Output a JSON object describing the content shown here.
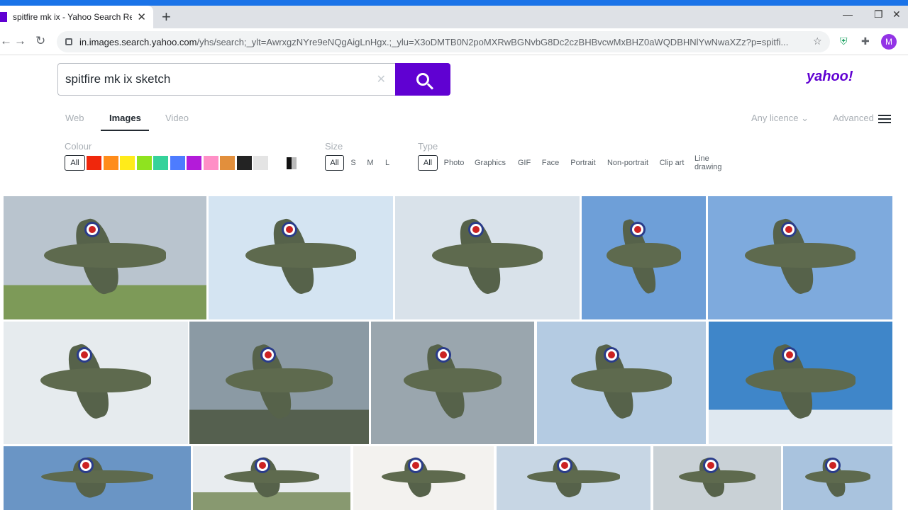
{
  "browser": {
    "tab_title": "spitfire mk ix - Yahoo Search Res",
    "tab_close": "✕",
    "new_tab": "+",
    "url_host": "in.images.search.yahoo.com",
    "url_path": "/yhs/search;_ylt=AwrxgzNYre9eNQgAigLnHgx.;_ylu=X3oDMTB0N2poMXRwBGNvbG8Dc2czBHBvcwMxBHZ0aWQDBHNlYwNwaXZz?p=spitfi...",
    "avatar_letter": "M",
    "minimize": "—",
    "restore": "❐",
    "close": "✕"
  },
  "search": {
    "query": "spitfire mk ix sketch",
    "clear": "✕"
  },
  "brand": "yahoo!",
  "vertical_tabs": [
    "Web",
    "Images",
    "Video"
  ],
  "right_options": {
    "licence": "Any licence",
    "advanced": "Advanced"
  },
  "filters": {
    "colour_label": "Colour",
    "colour_all": "All",
    "colours": [
      "#f0270c",
      "#ff8c1a",
      "#ffeb1a",
      "#8fe31f",
      "#35d29a",
      "#4d7cff",
      "#b31bd9",
      "#ff8fc6",
      "#e28f3c",
      "#232323",
      "#e4e4e4"
    ],
    "size_label": "Size",
    "sizes": [
      "All",
      "S",
      "M",
      "L"
    ],
    "type_label": "Type",
    "types": [
      "All",
      "Photo",
      "Graphics",
      "GIF",
      "Face",
      "Portrait",
      "Non-portrait",
      "Clip art",
      "Line drawing"
    ]
  },
  "results": [
    {
      "bg": "#b9c4ce",
      "ground": "#7d9a58"
    },
    {
      "bg": "#d4e4f2",
      "ground": ""
    },
    {
      "bg": "#d9e2ea",
      "ground": ""
    },
    {
      "bg": "#6e9fd8",
      "ground": ""
    },
    {
      "bg": "#7eaadd",
      "ground": ""
    },
    {
      "bg": "#e6ebee",
      "ground": ""
    },
    {
      "bg": "#8b9aa4",
      "ground": "#55604f"
    },
    {
      "bg": "#9aa6ae",
      "ground": ""
    },
    {
      "bg": "#b4cbe2",
      "ground": ""
    },
    {
      "bg": "#3f86c9",
      "ground": "#dfe8f0"
    },
    {
      "bg": "#6a95c5",
      "ground": ""
    },
    {
      "bg": "#e8ecef",
      "ground": "#889970"
    },
    {
      "bg": "#f3f2ef",
      "ground": ""
    },
    {
      "bg": "#c7d6e4",
      "ground": ""
    },
    {
      "bg": "#c9d1d6",
      "ground": ""
    },
    {
      "bg": "#a9c3de",
      "ground": ""
    }
  ]
}
